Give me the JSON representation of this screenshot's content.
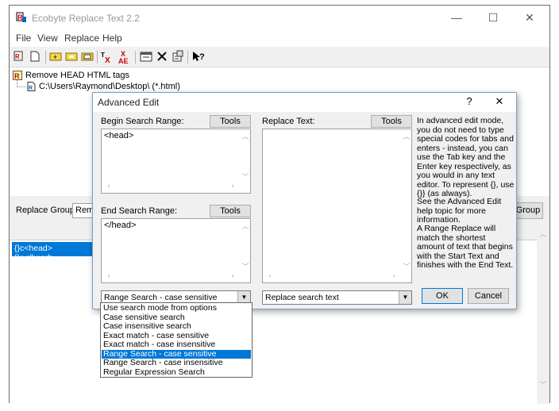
{
  "app": {
    "title": "Ecobyte Replace Text 2.2",
    "window_controls": {
      "minimize": "—",
      "maximize": "☐",
      "close": "✕"
    }
  },
  "menu": [
    "File",
    "View",
    "Replace",
    "Help"
  ],
  "tree": {
    "root_label": "Remove HEAD HTML tags",
    "child_label": "C:\\Users\\Raymond\\Desktop\\ (*.html)"
  },
  "main": {
    "replace_group_label": "Replace Group:",
    "replace_group_value": "Remo",
    "group_button": "Group",
    "list_row": "{}c<head>{}c</head>"
  },
  "dialog": {
    "title": "Advanced Edit",
    "help_glyph": "?",
    "close_glyph": "✕",
    "begin_label": "Begin Search Range:",
    "begin_value": "<head>",
    "end_label": "End Search Range:",
    "end_value": "</head>",
    "replace_label": "Replace Text:",
    "replace_value": "",
    "tools_label": "Tools",
    "help_text_1": "In advanced edit mode, you do not need to type special codes for tabs and enters - instead, you can use the Tab key and the Enter key respectively, as you would in any text editor. To represent {}, use {}} (as always).",
    "help_text_2": "See the Advanced Edit help topic for more information.",
    "help_text_3": "A Range Replace will match the shortest amount of text that begins with the Start Text and finishes with the End Text.",
    "search_mode_selected": "Range Search - case sensitive",
    "replace_mode_selected": "Replace search text",
    "ok": "OK",
    "cancel": "Cancel"
  },
  "dropdown_options": [
    "Use search mode from options",
    "Case sensitive search",
    "Case insensitive search",
    "Exact match - case sensitive",
    "Exact match - case insensitive",
    "Range Search - case sensitive",
    "Range Search - case insensitive",
    "Regular Expression Search"
  ],
  "dropdown_selected_index": 5,
  "colors": {
    "selection": "#0078d7",
    "dialog_border": "#7a9ccf"
  }
}
